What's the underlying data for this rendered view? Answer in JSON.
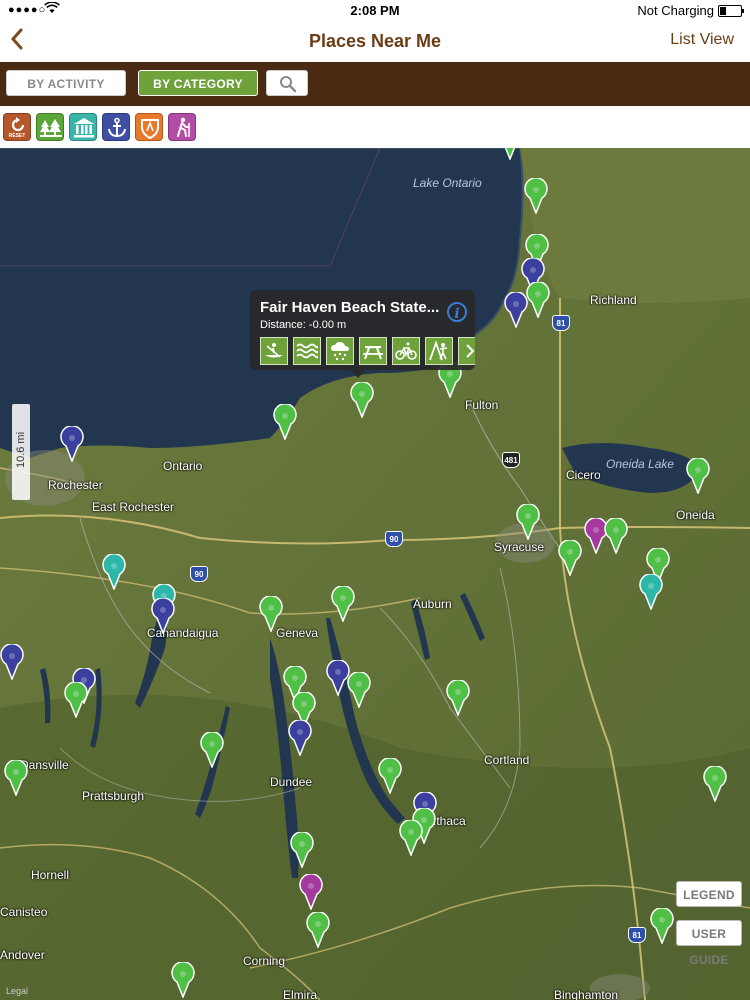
{
  "status_bar": {
    "signal": "●●●●○",
    "time": "2:08 PM",
    "charging": "Not Charging"
  },
  "nav": {
    "title": "Places Near Me",
    "list_view": "List View",
    "back_icon": "chevron-left-icon"
  },
  "filter": {
    "by_activity": "BY ACTIVITY",
    "by_category": "BY CATEGORY",
    "search_icon": "search-icon",
    "selected": "BY CATEGORY"
  },
  "categories": [
    {
      "icon": "reset-icon",
      "label": "RESET",
      "color": "#b5572a"
    },
    {
      "icon": "forest-icon",
      "color": "#5aa63a"
    },
    {
      "icon": "historic-building-icon",
      "color": "#3bb5a8"
    },
    {
      "icon": "anchor-icon",
      "color": "#3f4fa3"
    },
    {
      "icon": "shield-crest-icon",
      "color": "#e8782a"
    },
    {
      "icon": "hiker-icon",
      "color": "#b24da6"
    }
  ],
  "map": {
    "lakes": [
      {
        "name": "Lake Ontario"
      },
      {
        "name": "Oneida Lake"
      }
    ],
    "places": [
      "Fulton",
      "Richland",
      "Ontario",
      "Rochester",
      "East Rochester",
      "Cicero",
      "Oneida",
      "Syracuse",
      "Auburn",
      "Canandaigua",
      "Geneva",
      "Dansville",
      "Prattsburgh",
      "Dundee",
      "Cortland",
      "Ithaca",
      "Hornell",
      "Canisteo",
      "Andover",
      "Corning",
      "Elmira",
      "Binghamton"
    ],
    "highway_shields": [
      "81",
      "481",
      "90",
      "90",
      "81"
    ],
    "scale_label": "10.6 mi",
    "legal": "Legal",
    "legend_button": "LEGEND",
    "user_guide_button": "USER GUIDE"
  },
  "callout": {
    "title": "Fair Haven Beach State...",
    "distance": "Distance: -0.00 m",
    "info_icon": "info-icon",
    "activities": [
      "canoe-icon",
      "swimming-icon",
      "winter-weather-icon",
      "picnic-table-icon",
      "biking-icon",
      "playground-icon",
      "more-icon"
    ]
  },
  "pin_colors": {
    "green": "#4fbf46",
    "blue": "#3b3f9e",
    "teal": "#2cb7a8",
    "purple": "#a43a9e"
  }
}
